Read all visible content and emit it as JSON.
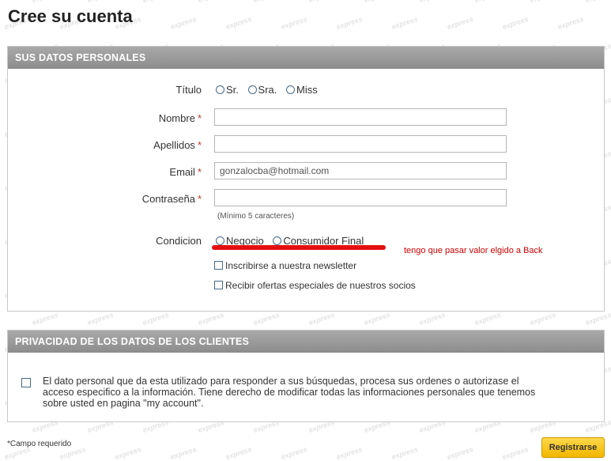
{
  "page": {
    "title": "Cree su cuenta",
    "watermark": "express"
  },
  "personal": {
    "header": "SUS DATOS PERSONALES",
    "titulo_label": "Título",
    "titulo_options": [
      "Sr.",
      "Sra.",
      "Miss"
    ],
    "nombre_label": "Nombre",
    "nombre_value": "",
    "apellidos_label": "Apellidos",
    "apellidos_value": "",
    "email_label": "Email",
    "email_value": "gonzalocba@hotmail.com",
    "password_label": "Contraseña",
    "password_value": "",
    "password_hint": "(Mínimo 5 caracteres)",
    "required_mark": "*",
    "condicion_label": "Condicion",
    "condicion_options": [
      "Negocio",
      "Consumidor Final"
    ],
    "annotation": "tengo que pasar valor elgido a Back",
    "newsletter_label": "Inscribirse a nuestra newsletter",
    "offers_label": "Recibir ofertas especiales de nuestros socios"
  },
  "privacy": {
    "header": "PRIVACIDAD DE LOS DATOS DE LOS CLIENTES",
    "text": "El dato personal que da esta utilizado para responder a sus búsquedas, procesa sus ordenes o autorizase el acceso especifico a la información. Tiene derecho de modificar todas las informaciones personales que tenemos sobre usted en pagina \"my account\"."
  },
  "footer": {
    "required_note": "*Campo requerido",
    "submit_label": "Registrarse"
  },
  "colors": {
    "header_bg": "#999999",
    "annotation": "#e41010",
    "submit_bg": "#f5c518"
  }
}
